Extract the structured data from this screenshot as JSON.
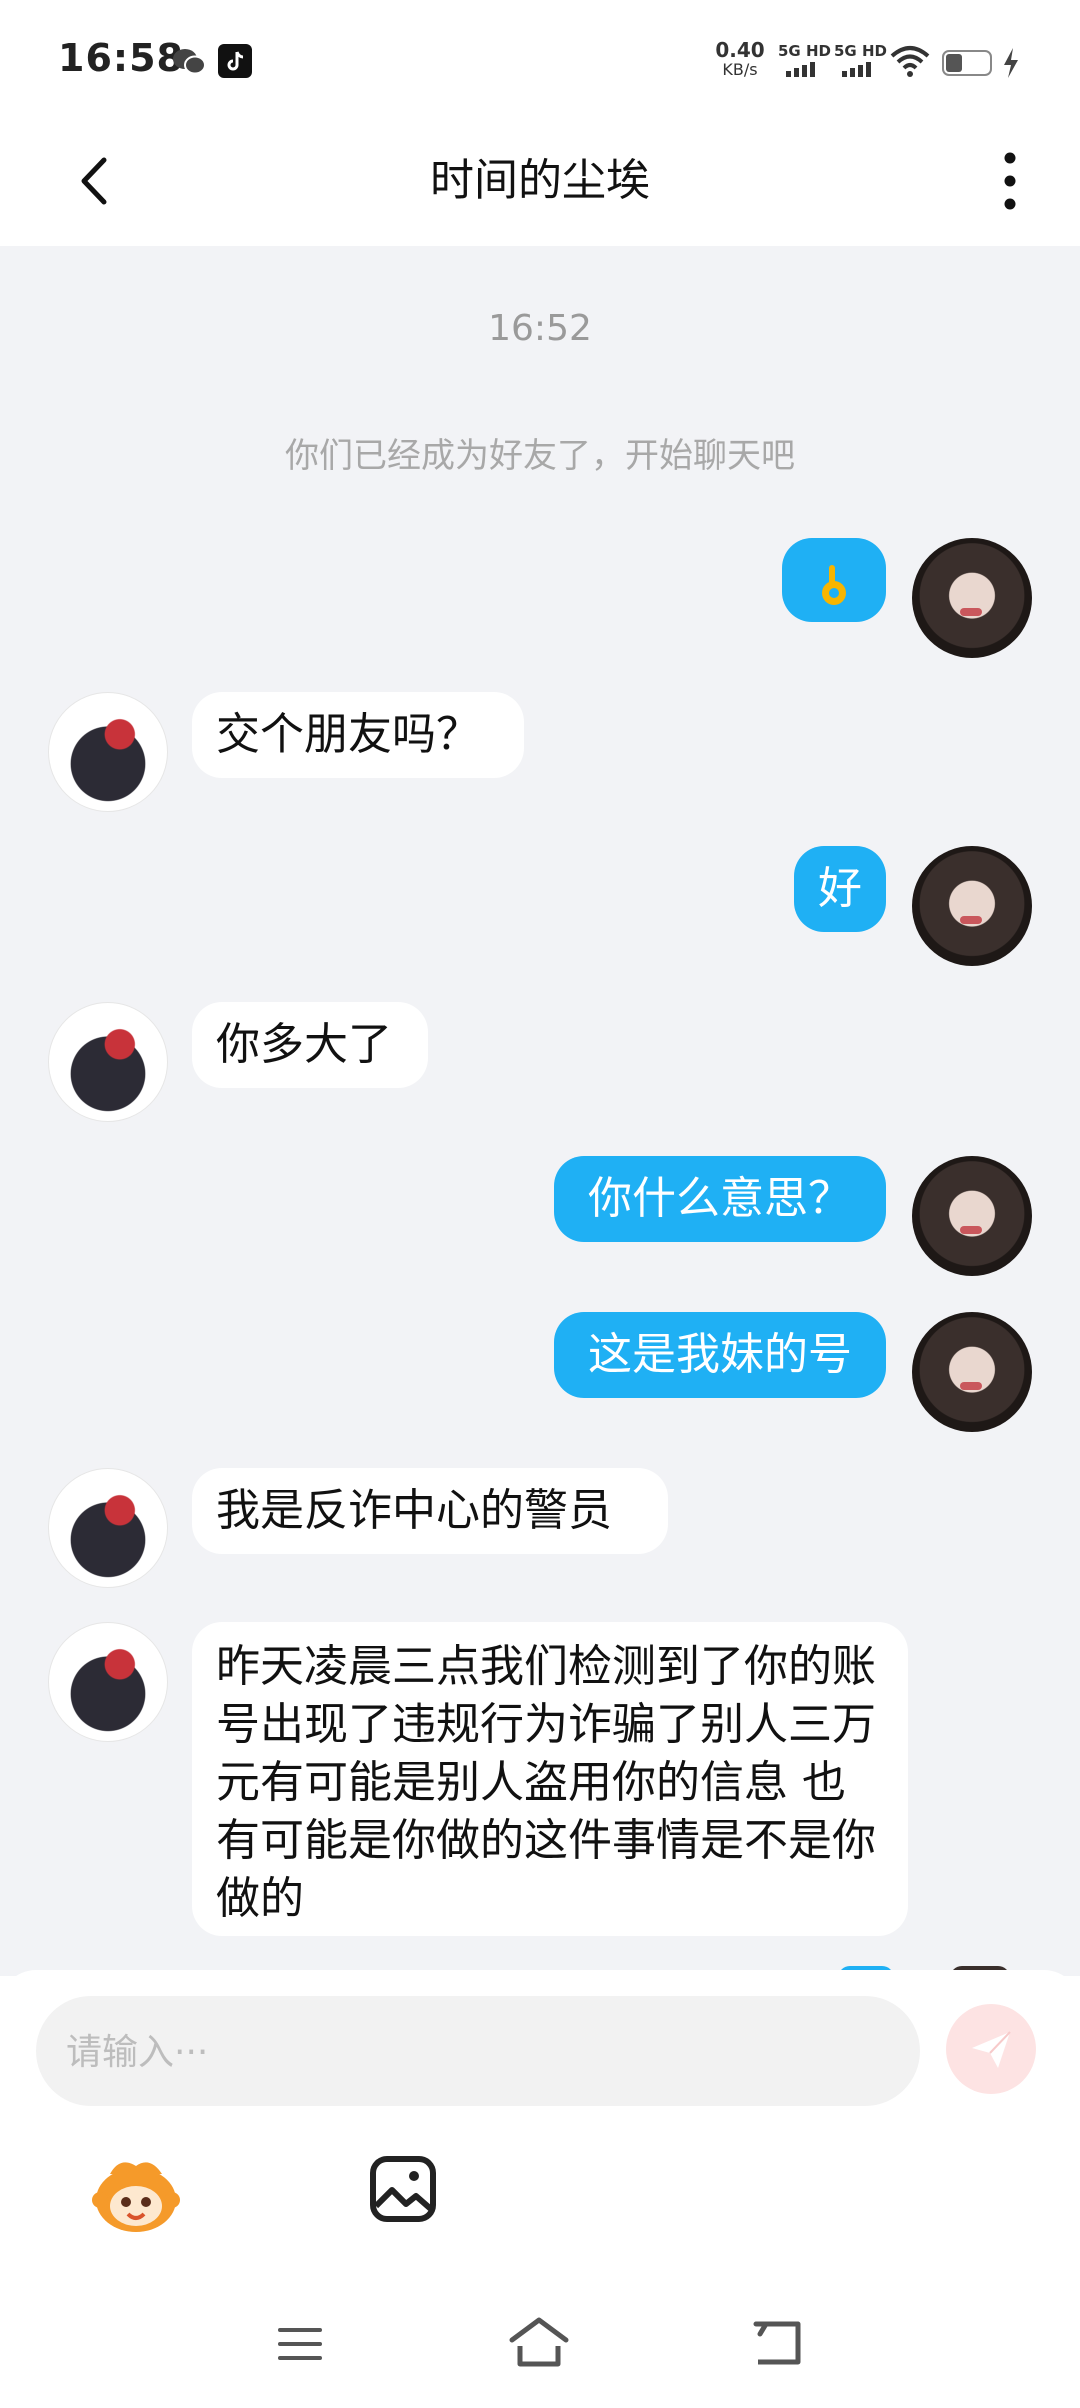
{
  "status_bar": {
    "time": "16:58",
    "net_speed": "0.40",
    "net_speed_unit": "KB/s",
    "sim1": "5G HD",
    "sim2": "5G HD"
  },
  "header": {
    "title": "时间的尘埃"
  },
  "chat": {
    "timestamp": "16:52",
    "system_note": "你们已经成为好友了，开始聊天吧",
    "messages": [
      {
        "sender": "me",
        "emoji": "ok-hand-emoji"
      },
      {
        "sender": "other",
        "text": "交个朋友吗？"
      },
      {
        "sender": "me",
        "text": "好"
      },
      {
        "sender": "other",
        "text": "你多大了"
      },
      {
        "sender": "me",
        "text": "你什么意思？"
      },
      {
        "sender": "me",
        "text": "这是我妹的号"
      },
      {
        "sender": "other",
        "text": "我是反诈中心的警员"
      },
      {
        "sender": "other",
        "text": "昨天凌晨三点我们检测到了你的账号出现了违规行为诈骗了别人三万元有可能是别人盗用你的信息  也有可能是你做的这件事情是不是你做的"
      }
    ]
  },
  "input": {
    "placeholder": "请输入···"
  },
  "colors": {
    "my_bubble": "#1fb0f4",
    "other_bubble": "#ffffff",
    "chat_background": "#f2f3f6",
    "send_button_bg": "#fde3e3"
  },
  "icons": [
    "back-arrow-icon",
    "more-vertical-icon",
    "send-icon",
    "emoji-mascot-icon",
    "image-icon",
    "menu-icon",
    "home-icon",
    "back-icon"
  ]
}
